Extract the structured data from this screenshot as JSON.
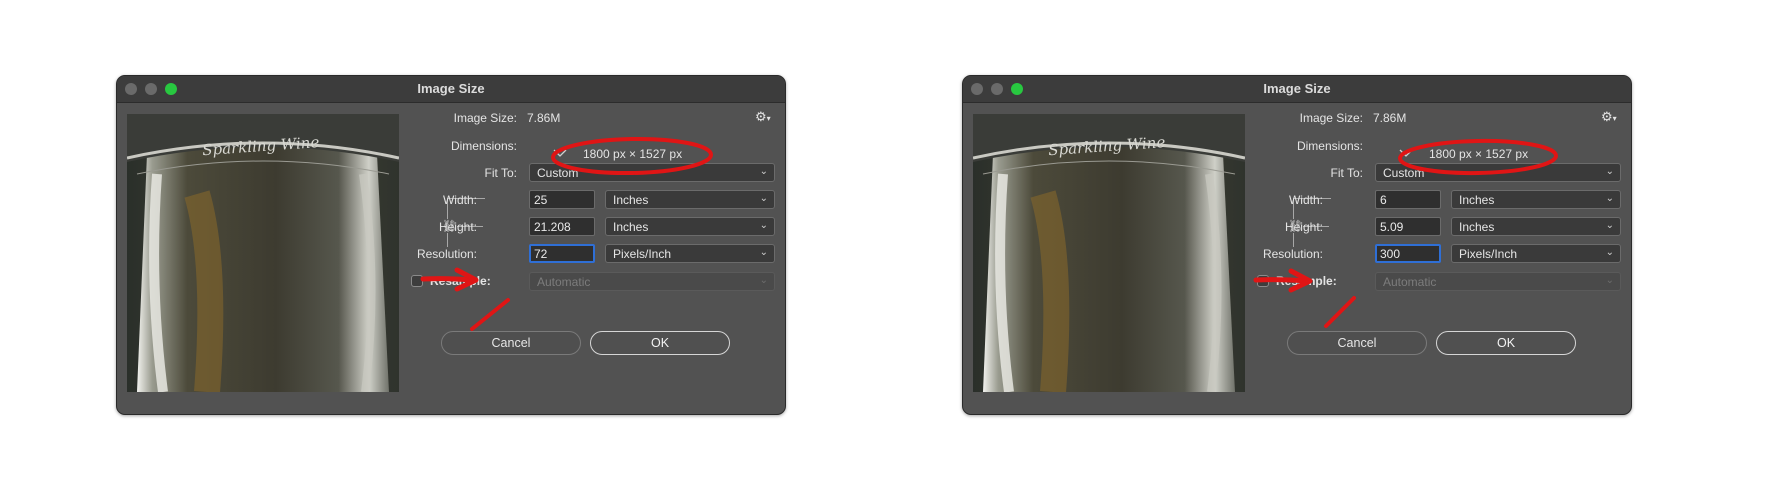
{
  "dialogs": [
    {
      "title": "Image Size",
      "image_size_label": "Image Size:",
      "image_size_value": "7.86M",
      "dimensions_label": "Dimensions:",
      "dimensions_value": "1800 px  ×  1527 px",
      "fit_to_label": "Fit To:",
      "fit_to_value": "Custom",
      "width_label": "Width:",
      "width_value": "25",
      "width_unit": "Inches",
      "height_label": "Height:",
      "height_value": "21.208",
      "height_unit": "Inches",
      "resolution_label": "Resolution:",
      "resolution_value": "72",
      "resolution_unit": "Pixels/Inch",
      "resample_label": "Resample:",
      "resample_value": "Automatic",
      "resample_checked": false,
      "cancel_label": "Cancel",
      "ok_label": "OK",
      "preview_text": "Sparkling Wine"
    },
    {
      "title": "Image Size",
      "image_size_label": "Image Size:",
      "image_size_value": "7.86M",
      "dimensions_label": "Dimensions:",
      "dimensions_value": "1800 px  ×  1527 px",
      "fit_to_label": "Fit To:",
      "fit_to_value": "Custom",
      "width_label": "Width:",
      "width_value": "6",
      "width_unit": "Inches",
      "height_label": "Height:",
      "height_value": "5.09",
      "height_unit": "Inches",
      "resolution_label": "Resolution:",
      "resolution_value": "300",
      "resolution_unit": "Pixels/Inch",
      "resample_label": "Resample:",
      "resample_value": "Automatic",
      "resample_checked": false,
      "cancel_label": "Cancel",
      "ok_label": "OK",
      "preview_text": "Sparkling Wine"
    }
  ],
  "icons": {
    "gear": "gear-icon",
    "link": "link-icon",
    "chevron": "chevron-down-icon"
  },
  "colors": {
    "dialog_bg": "#525252",
    "titlebar_bg": "#3c3c3c",
    "focus_ring": "#2f6fd6",
    "annotation_red": "#e01515",
    "green_button": "#28c840"
  }
}
